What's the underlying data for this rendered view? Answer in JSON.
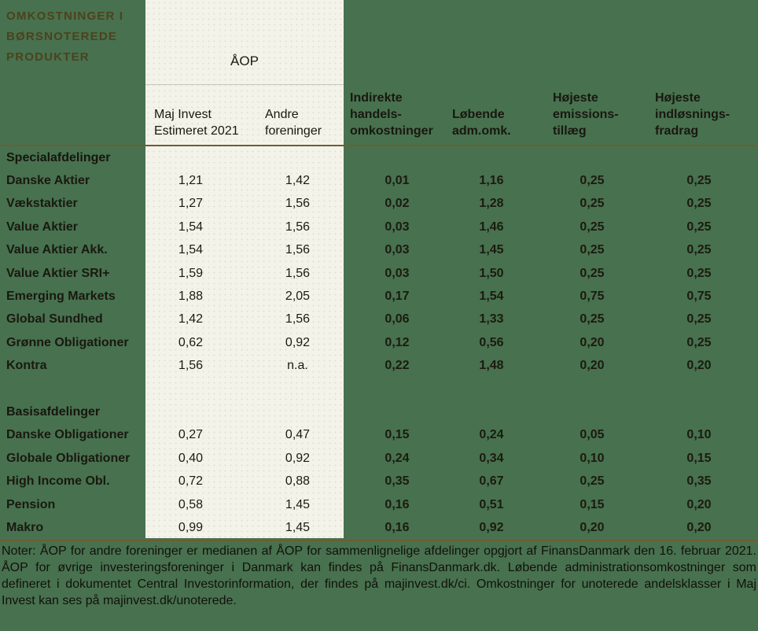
{
  "colors": {
    "background": "#48714f",
    "panel": "#f4f3ea",
    "divider": "#6e5e32",
    "title_text": "#4b431d",
    "body_text": "#1b1b10"
  },
  "header": {
    "title": "OMKOSTNINGER I\nBØRSNOTEREDE\nPRODUKTER",
    "aop_label": "ÅOP",
    "columns": [
      {
        "id": "aop-maj-invest",
        "label": "Maj Invest\nEstimeret 2021"
      },
      {
        "id": "aop-andre-foreninger",
        "label": "Andre\nforeninger"
      },
      {
        "id": "indirekte-handelsomkostninger",
        "label": "Indirekte\nhandels-\nomkostninger"
      },
      {
        "id": "lobende-adm-omk",
        "label": "Løbende\nadm.omk."
      },
      {
        "id": "hojeste-emissionstillaeg",
        "label": "Højeste\nemissions-\ntillæg"
      },
      {
        "id": "hojeste-indlosningsfradrag",
        "label": "Højeste\nindløsnings-\nfradrag"
      }
    ]
  },
  "table": {
    "sections": [
      {
        "title": "Specialafdelinger",
        "rows": [
          {
            "label": "Danske Aktier",
            "values": [
              "1,21",
              "1,42",
              "0,01",
              "1,16",
              "0,25",
              "0,25"
            ]
          },
          {
            "label": "Vækstaktier",
            "values": [
              "1,27",
              "1,56",
              "0,02",
              "1,28",
              "0,25",
              "0,25"
            ]
          },
          {
            "label": "Value Aktier",
            "values": [
              "1,54",
              "1,56",
              "0,03",
              "1,46",
              "0,25",
              "0,25"
            ]
          },
          {
            "label": "Value Aktier Akk.",
            "values": [
              "1,54",
              "1,56",
              "0,03",
              "1,45",
              "0,25",
              "0,25"
            ]
          },
          {
            "label": "Value Aktier SRI+",
            "values": [
              "1,59",
              "1,56",
              "0,03",
              "1,50",
              "0,25",
              "0,25"
            ]
          },
          {
            "label": "Emerging Markets",
            "values": [
              "1,88",
              "2,05",
              "0,17",
              "1,54",
              "0,75",
              "0,75"
            ]
          },
          {
            "label": "Global Sundhed",
            "values": [
              "1,42",
              "1,56",
              "0,06",
              "1,33",
              "0,25",
              "0,25"
            ]
          },
          {
            "label": "Grønne Obligationer",
            "values": [
              "0,62",
              "0,92",
              "0,12",
              "0,56",
              "0,20",
              "0,25"
            ]
          },
          {
            "label": "Kontra",
            "values": [
              "1,56",
              "n.a.",
              "0,22",
              "1,48",
              "0,20",
              "0,20"
            ]
          }
        ]
      },
      {
        "title": "Basisafdelinger",
        "rows": [
          {
            "label": "Danske Obligationer",
            "values": [
              "0,27",
              "0,47",
              "0,15",
              "0,24",
              "0,05",
              "0,10"
            ]
          },
          {
            "label": "Globale Obligationer",
            "values": [
              "0,40",
              "0,92",
              "0,24",
              "0,34",
              "0,10",
              "0,15"
            ]
          },
          {
            "label": "High Income Obl.",
            "values": [
              "0,72",
              "0,88",
              "0,35",
              "0,67",
              "0,25",
              "0,35"
            ]
          },
          {
            "label": "Pension",
            "values": [
              "0,58",
              "1,45",
              "0,16",
              "0,51",
              "0,15",
              "0,20"
            ]
          },
          {
            "label": "Makro",
            "values": [
              "0,99",
              "1,45",
              "0,16",
              "0,92",
              "0,20",
              "0,20"
            ]
          }
        ]
      }
    ]
  },
  "footer": {
    "notes": "Noter: ÅOP for andre foreninger er medianen af ÅOP for sammenlignelige afdelinger opgjort af FinansDanmark den 16. februar 2021. ÅOP for øvrige investeringsforeninger i Danmark kan findes på FinansDanmark.dk. Løbende administrationsomkostninger som defineret i dokumentet Central Investorinformation, der findes på majinvest.dk/ci. Omkostninger for unoterede andelsklasser i Maj Invest kan ses på majinvest.dk/unoterede."
  }
}
